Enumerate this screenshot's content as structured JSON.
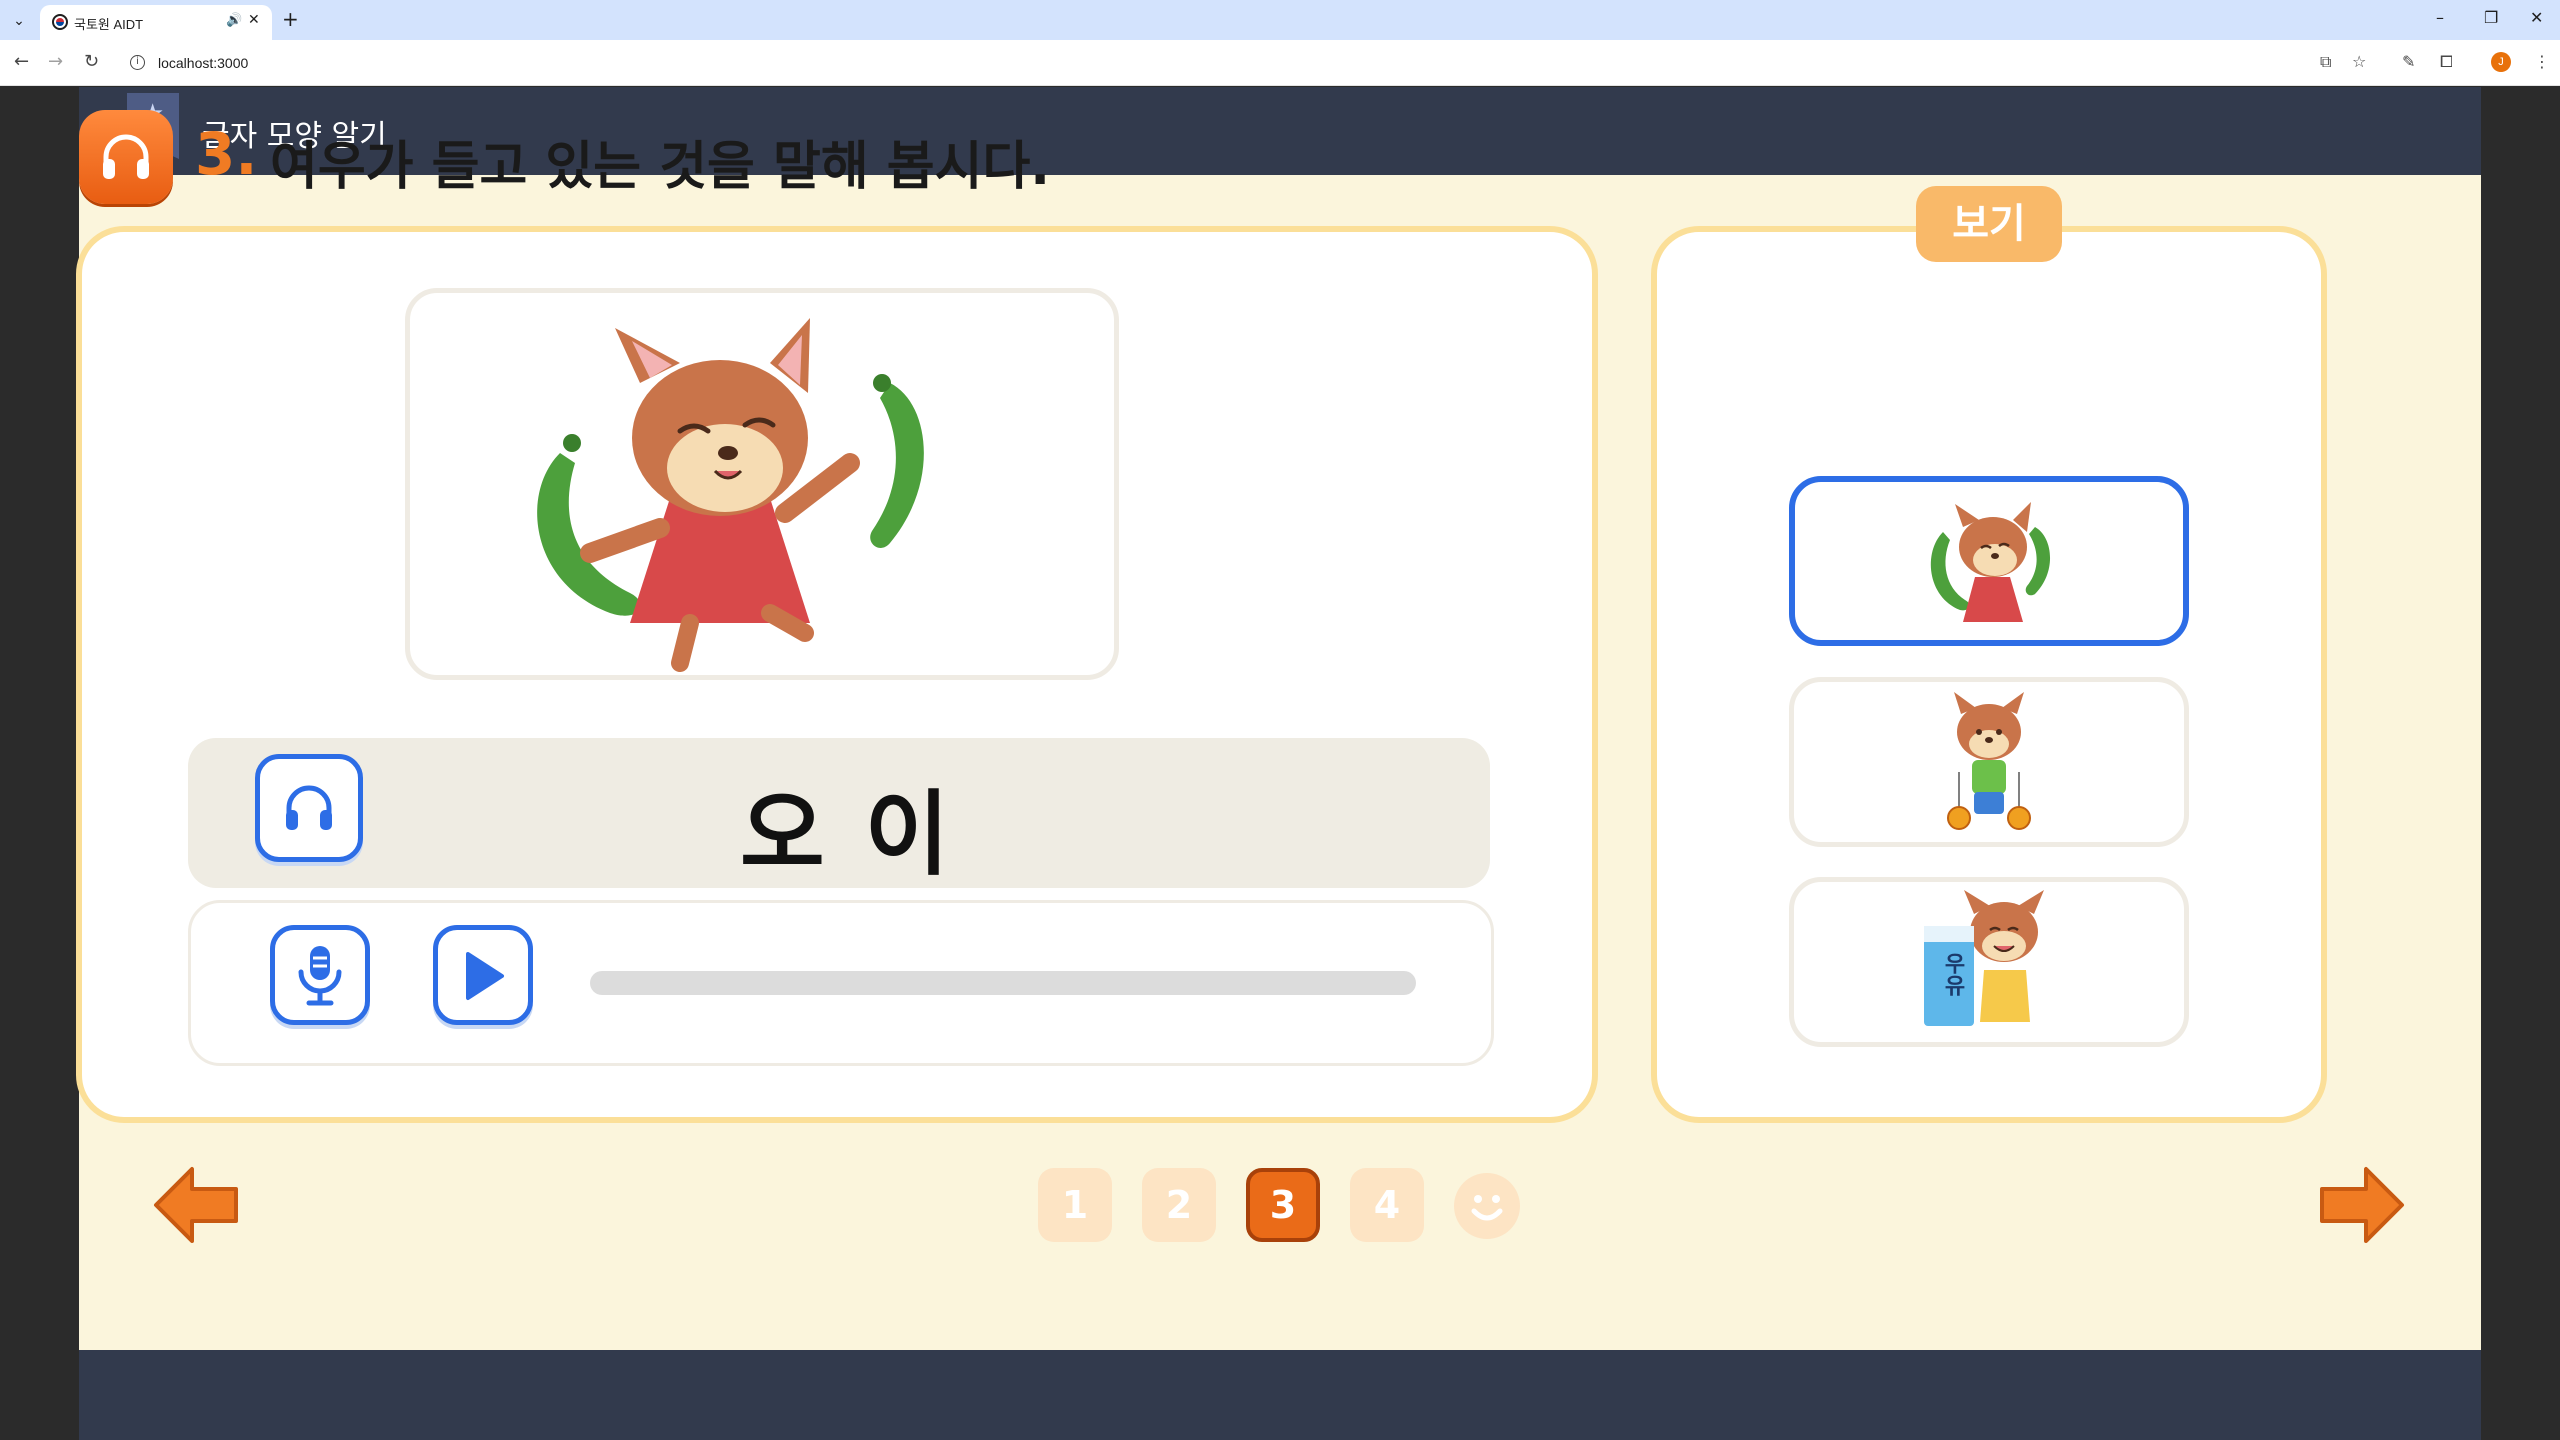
{
  "browser": {
    "tab_title": "국토원 AIDT",
    "url": "localhost:3000",
    "profile_initial": "J"
  },
  "header": {
    "title": "글자 모양 알기"
  },
  "question": {
    "number": "3.",
    "text": "여우가 들고 있는 것을 말해 봅시다."
  },
  "main": {
    "word": "오 이",
    "recording_progress": 0
  },
  "side": {
    "label": "보기",
    "options": [
      {
        "name": "fox-with-cucumbers",
        "selected": true
      },
      {
        "name": "fox-with-yoyos",
        "selected": false
      },
      {
        "name": "fox-with-milk",
        "selected": false
      }
    ],
    "milk_text": "우유"
  },
  "pagination": {
    "pages": [
      "1",
      "2",
      "3",
      "4"
    ],
    "current": "3"
  },
  "colors": {
    "accent_orange": "#ea6b18",
    "accent_blue": "#2d6de6",
    "panel_border": "#fbdf98",
    "header_bg": "#323a4d"
  }
}
